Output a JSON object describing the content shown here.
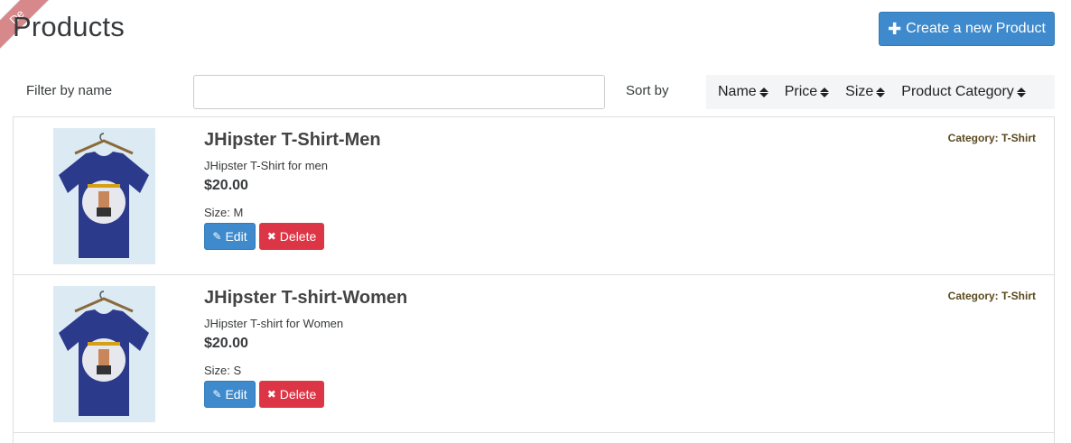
{
  "ribbon": {
    "text": "De"
  },
  "page": {
    "title": "Products"
  },
  "toolbar": {
    "create_label": "Create a new Product",
    "create_icon": "plus-icon"
  },
  "filter": {
    "label": "Filter by name",
    "value": "",
    "placeholder": ""
  },
  "sort": {
    "label": "Sort by",
    "options": [
      {
        "label": "Name"
      },
      {
        "label": "Price"
      },
      {
        "label": "Size"
      },
      {
        "label": "Product Category"
      }
    ]
  },
  "products": [
    {
      "name": "JHipster T-Shirt-Men",
      "description": "JHipster T-Shirt for men",
      "price": "$20.00",
      "size": "Size: M",
      "category": "Category: T-Shirt",
      "edit_label": "Edit",
      "delete_label": "Delete"
    },
    {
      "name": "JHipster T-shirt-Women",
      "description": "JHipster T-shirt for Women",
      "price": "$20.00",
      "size": "Size: S",
      "category": "Category: T-Shirt",
      "edit_label": "Edit",
      "delete_label": "Delete"
    }
  ],
  "colors": {
    "primary": "#3e8acc",
    "danger": "#dc3545",
    "shirt": "#2c3a8c",
    "thumb_bg": "#dceaf4"
  }
}
